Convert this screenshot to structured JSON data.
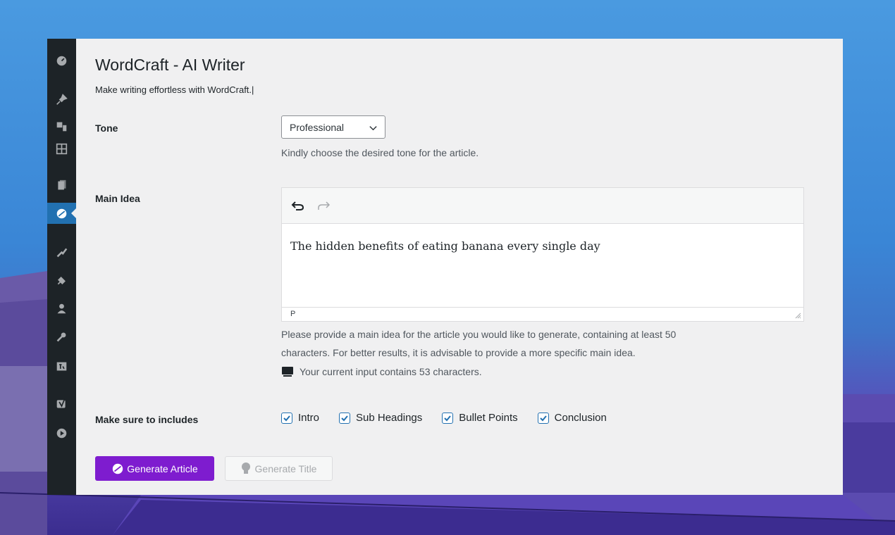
{
  "app": {
    "title": "WordCraft - AI Writer",
    "subtitle": "Make writing effortless with WordCraft.|"
  },
  "colors": {
    "accent": "#7e1ccf",
    "sidebar_bg": "#1d2327",
    "active_menu": "#2271b1",
    "checkbox": "#2271b1"
  },
  "sidebar": {
    "items": [
      {
        "icon": "dashboard-icon"
      },
      {
        "icon": "pin-icon"
      },
      {
        "icon": "media-icon"
      },
      {
        "icon": "grid-icon"
      },
      {
        "icon": "pages-icon"
      },
      {
        "icon": "wordcraft-icon",
        "active": true
      },
      {
        "icon": "appearance-icon"
      },
      {
        "icon": "plugins-icon"
      },
      {
        "icon": "users-icon"
      },
      {
        "icon": "tools-icon"
      },
      {
        "icon": "settings-icon"
      },
      {
        "icon": "yoast-icon"
      },
      {
        "icon": "play-icon"
      }
    ]
  },
  "tone": {
    "label": "Tone",
    "selected": "Professional",
    "help": "Kindly choose the desired tone for the article."
  },
  "main_idea": {
    "label": "Main Idea",
    "value": "The hidden benefits of eating banana every single day",
    "status_path": "P",
    "help_line1": "Please provide a main idea for the article you would like to generate, containing at least 50",
    "help_line2": "characters. For better results, it is advisable to provide a more specific main idea.",
    "counter": "Your current input contains 53 characters."
  },
  "includes": {
    "label": "Make sure to includes",
    "options": [
      {
        "label": "Intro",
        "checked": true
      },
      {
        "label": "Sub Headings",
        "checked": true
      },
      {
        "label": "Bullet Points",
        "checked": true
      },
      {
        "label": "Conclusion",
        "checked": true
      }
    ]
  },
  "actions": {
    "generate_article": "Generate Article",
    "generate_title": "Generate Title"
  }
}
